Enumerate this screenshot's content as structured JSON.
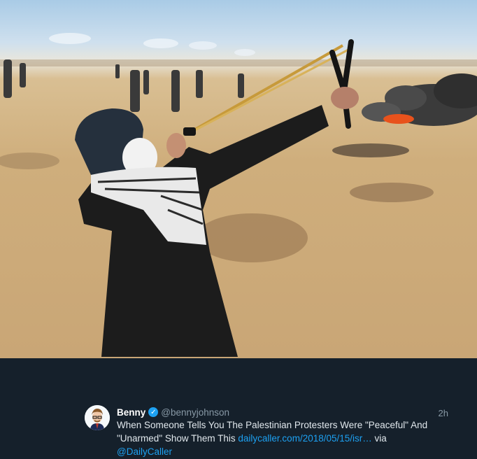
{
  "tweet": {
    "name": "Benny",
    "verified_icon": "verified-badge-icon",
    "handle": "@bennyjohnson",
    "time": "2h",
    "text_part1": "When Someone Tells You The Palestinian Protesters Were \"Peaceful\" And \"Unarmed\" Show Them This ",
    "link_text": "dailycaller.com/2018/05/15/isr…",
    "text_part2": " via ",
    "mention": "@DailyCaller"
  },
  "photo": {
    "subject": "protest-photo",
    "colors": {
      "sky": "#a9cbe6",
      "ground": "#cfae7c",
      "smoke": "#3a3a3a",
      "fire": "#e8521c",
      "clothing": "#1c1c1c"
    }
  },
  "theme": {
    "background": "#15202b",
    "link": "#1da1f2",
    "muted": "#8899a6",
    "text": "#e1e8ed"
  }
}
